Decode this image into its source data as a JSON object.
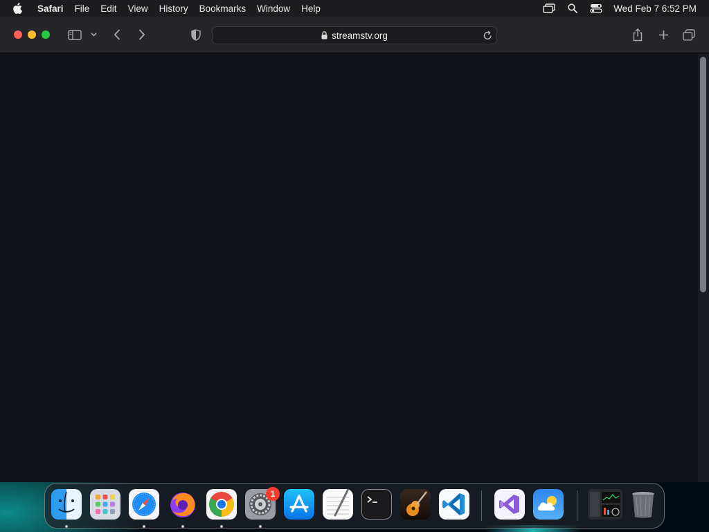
{
  "menubar": {
    "app_name": "Safari",
    "items": [
      "File",
      "Edit",
      "View",
      "History",
      "Bookmarks",
      "Window",
      "Help"
    ],
    "clock": "Wed Feb 7  6:52 PM"
  },
  "browser": {
    "url": "streamstv.org"
  },
  "dock": {
    "apps": [
      "Finder",
      "Launchpad",
      "Safari",
      "Firefox",
      "Chrome",
      "System Settings",
      "App Store",
      "TextEdit",
      "Terminal",
      "GarageBand",
      "Visual Studio Code",
      "Visual Studio",
      "Weather",
      "Activity Monitor",
      "Trash"
    ],
    "settings_badge": "1"
  },
  "colors": {
    "close": "#fe5f57",
    "minimize": "#febc2e",
    "zoom": "#28c840",
    "page_background": "#10121a"
  }
}
